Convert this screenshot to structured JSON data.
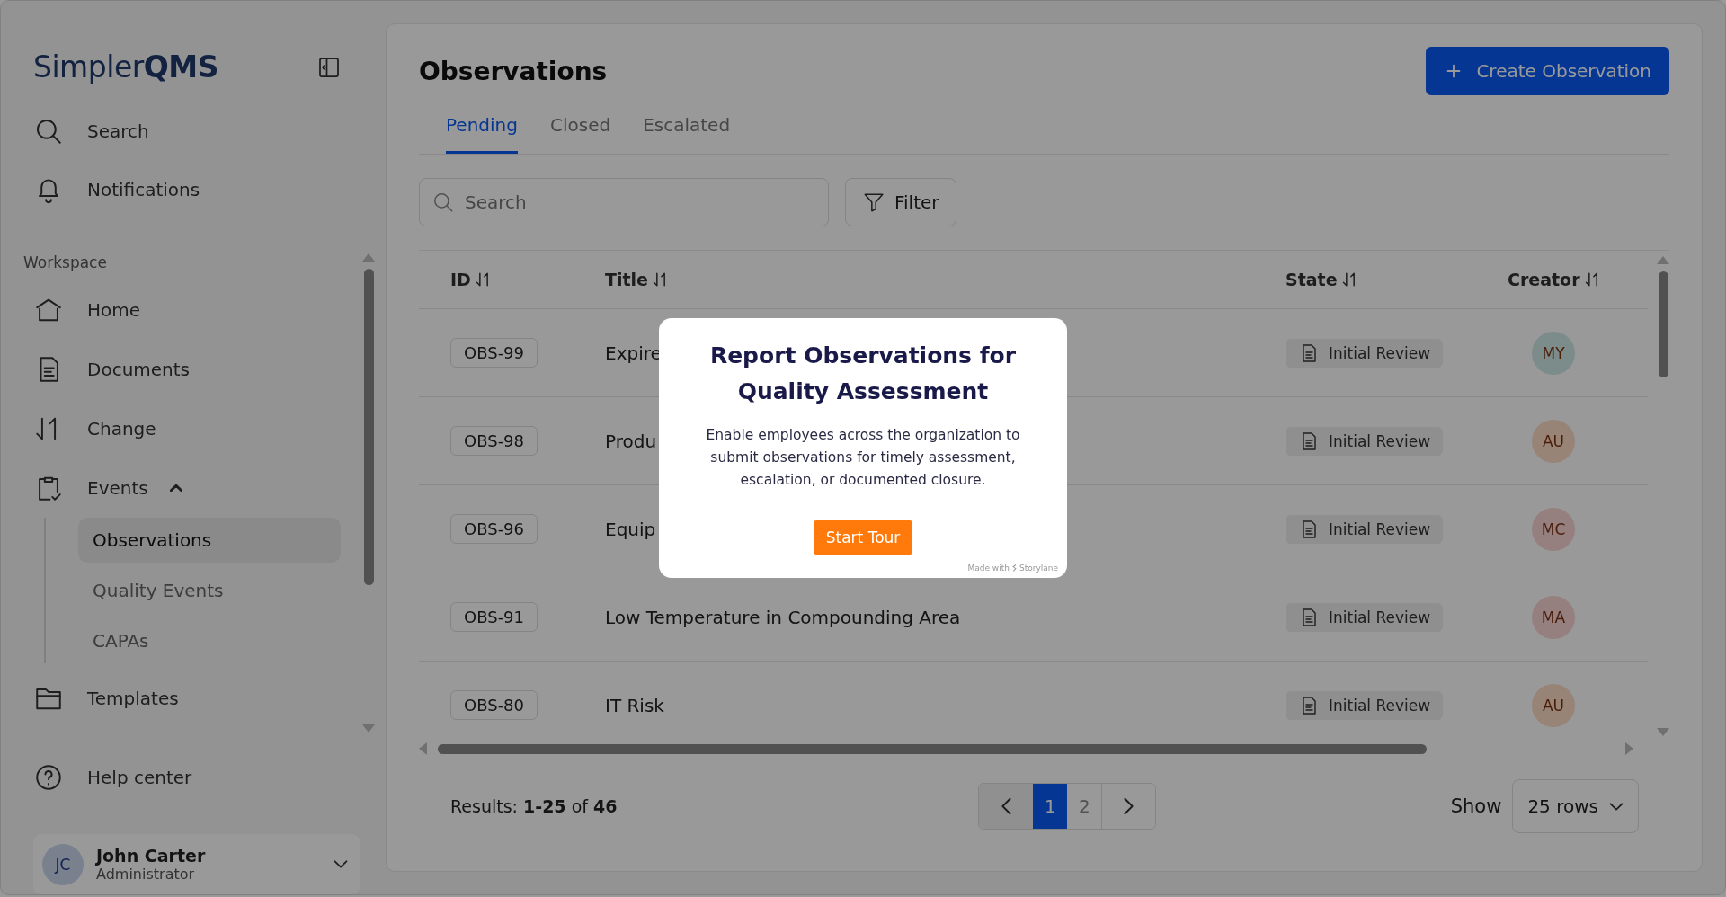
{
  "sidebar": {
    "logo": "Simpler**QMS**",
    "top_items": [
      {
        "label": "Search"
      },
      {
        "label": "Notifications"
      }
    ],
    "section": "Workspace",
    "nav": [
      {
        "label": "Home"
      },
      {
        "label": "Documents"
      },
      {
        "label": "Change"
      },
      {
        "label": "Events",
        "expanded": true,
        "children": [
          {
            "label": "Observations",
            "selected": true
          },
          {
            "label": "Quality Events",
            "selected": false
          },
          {
            "label": "CAPAs",
            "selected": false
          }
        ]
      },
      {
        "label": "Templates"
      }
    ],
    "help": "Help center",
    "user": {
      "initials": "JC",
      "name": "John Carter",
      "role": "Administrator"
    }
  },
  "main": {
    "title": "Observations",
    "create_button": "Create Observation",
    "tabs": [
      {
        "label": "Pending",
        "selected": true
      },
      {
        "label": "Closed",
        "selected": false
      },
      {
        "label": "Escalated",
        "selected": false
      }
    ],
    "search": {
      "placeholder": "Search"
    },
    "filter": "Filter",
    "table": {
      "columns": [
        "ID",
        "Title",
        "State",
        "Creator"
      ],
      "rows": [
        {
          "id": "OBS-99",
          "title": "Expire",
          "state": "Initial Review",
          "creator": {
            "initials": "MY",
            "color": "#7b8c8a"
          }
        },
        {
          "id": "OBS-98",
          "title": "Produ",
          "state": "Initial Review",
          "creator": {
            "initials": "AU",
            "color": "#978476"
          }
        },
        {
          "id": "OBS-96",
          "title": "Equip",
          "state": "Initial Review",
          "creator": {
            "initials": "MC",
            "color": "#957f7f"
          }
        },
        {
          "id": "OBS-91",
          "title": "Low Temperature in Compounding Area",
          "state": "Initial Review",
          "creator": {
            "initials": "MA",
            "color": "#957f7f"
          }
        },
        {
          "id": "OBS-80",
          "title": "IT Risk",
          "state": "Initial Review",
          "creator": {
            "initials": "AU",
            "color": "#978476"
          }
        }
      ]
    },
    "results": "Results: **1-25** of **46**",
    "pages": [
      {
        "label": "1",
        "selected": true
      },
      {
        "label": "2",
        "selected": false
      }
    ],
    "show_label": "Show",
    "rows_select": "25 rows"
  },
  "modal": {
    "title": "Report Observations for Quality Assessment",
    "body": "Enable employees across the organization to submit observations for timely assessment, escalation, or documented closure.",
    "button": "Start Tour",
    "credit": [
      "Made with",
      "Storylane"
    ]
  }
}
